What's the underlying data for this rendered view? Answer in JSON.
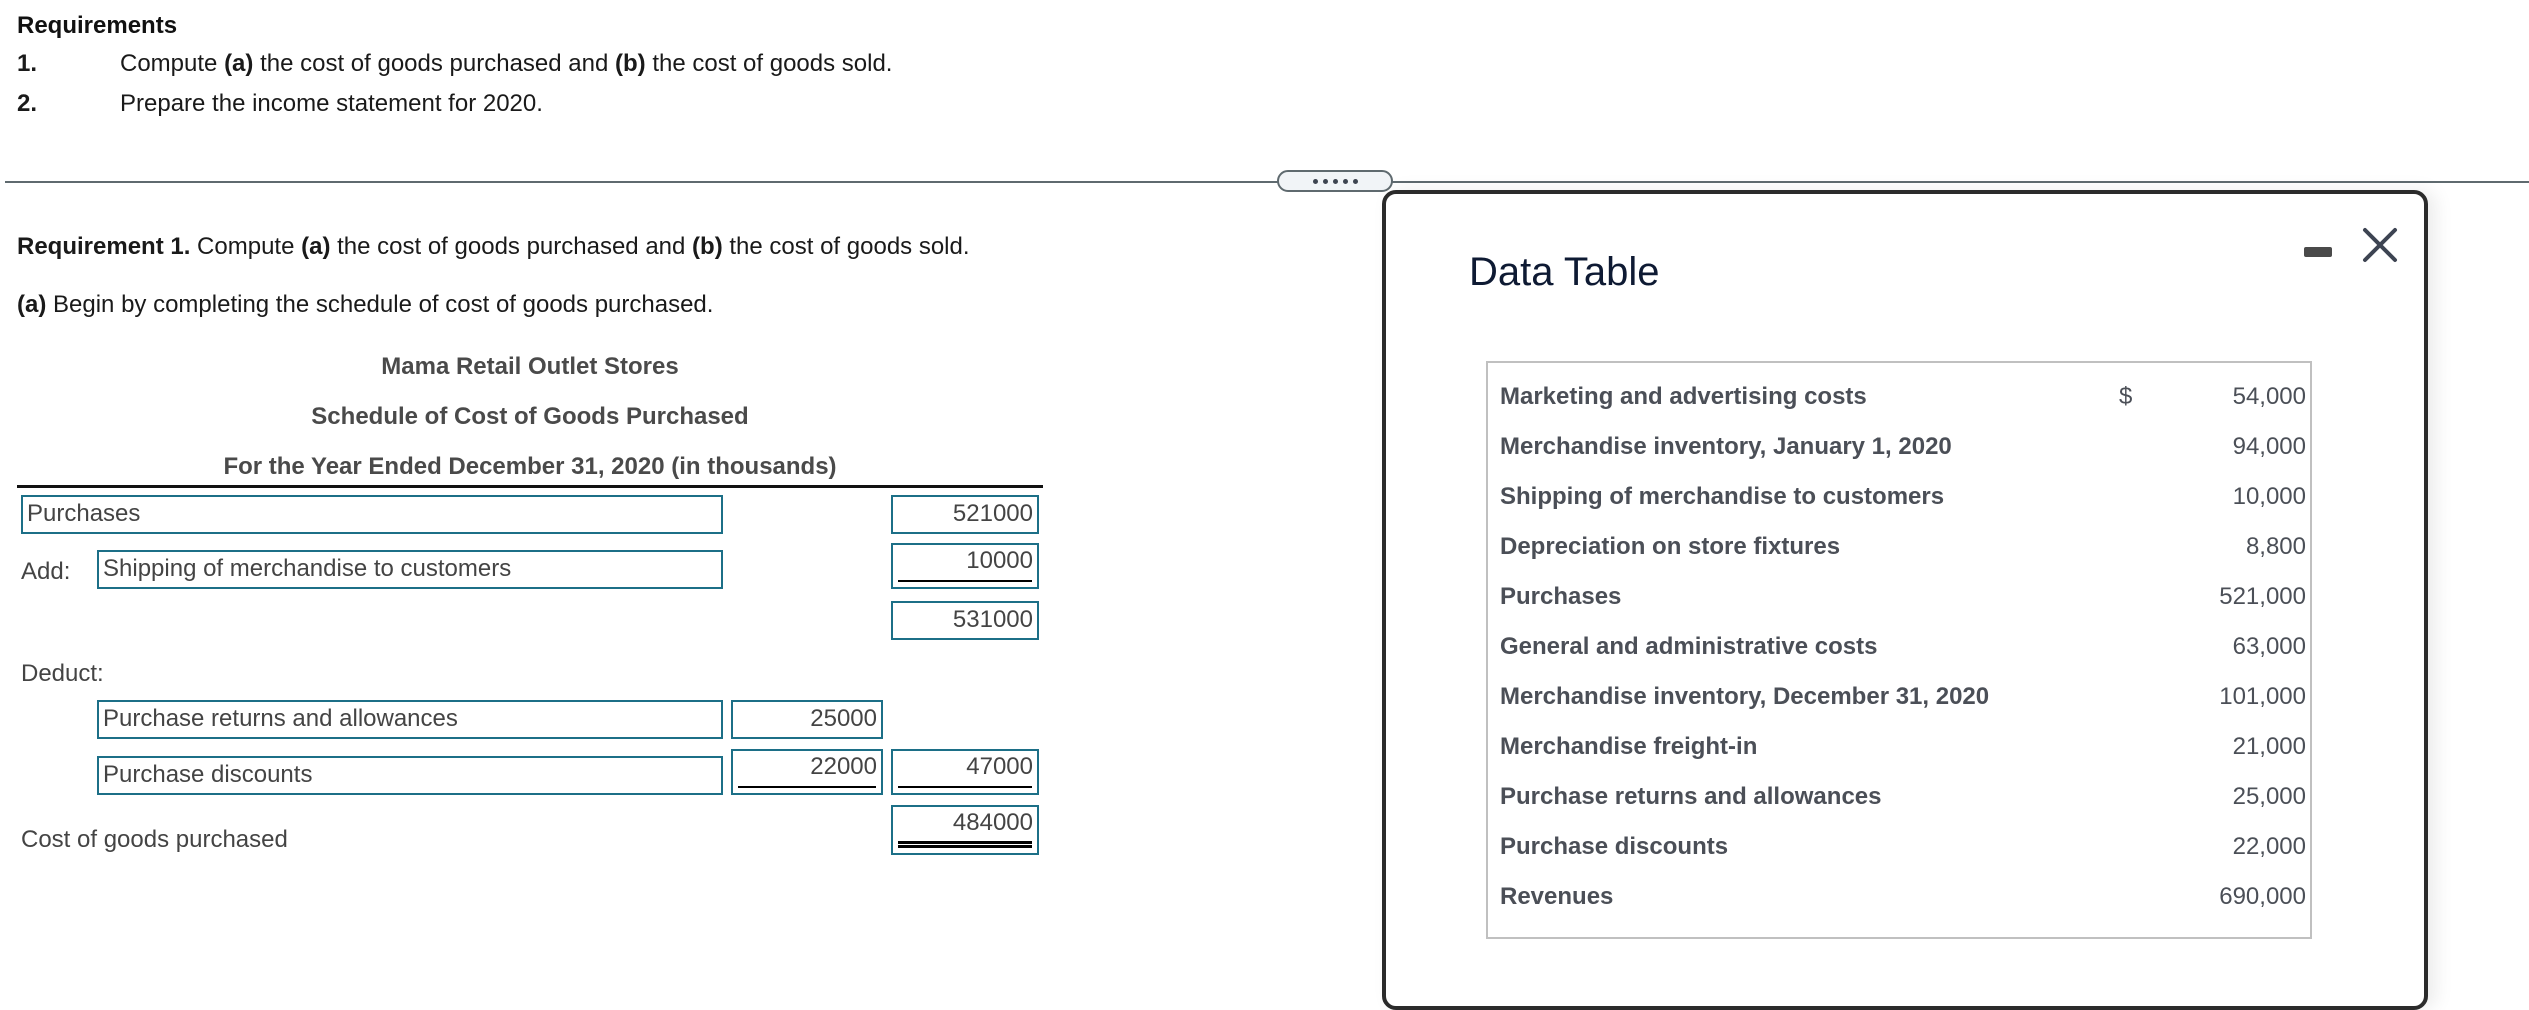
{
  "requirements": {
    "title": "Requirements",
    "items": [
      {
        "num": "1.",
        "parts": [
          {
            "t": "Compute ",
            "b": false
          },
          {
            "t": "(a)",
            "b": true
          },
          {
            "t": " the cost of goods purchased and ",
            "b": false
          },
          {
            "t": "(b)",
            "b": true
          },
          {
            "t": " the cost of goods sold.",
            "b": false
          }
        ]
      },
      {
        "num": "2.",
        "parts": [
          {
            "t": "Prepare the income statement for 2020.",
            "b": false
          }
        ]
      }
    ]
  },
  "question": {
    "req1_bold": "Requirement 1.",
    "req1_text_a": " Compute ",
    "req1_a": "(a)",
    "req1_text_b": " the cost of goods purchased and ",
    "req1_b": "(b)",
    "req1_text_c": " the cost of goods sold.",
    "part_a_bold": "(a)",
    "part_a_text": " Begin by completing the schedule of cost of goods purchased."
  },
  "schedule": {
    "company": "Mama Retail Outlet Stores",
    "title": "Schedule of Cost of Goods Purchased",
    "period": "For the Year Ended December 31, 2020 (in thousands)",
    "add_label": "Add:",
    "deduct_label": "Deduct:",
    "total_label": "Cost of goods purchased",
    "rows": {
      "purchases": {
        "label": "Purchases",
        "value": "521000"
      },
      "shipping": {
        "label": "Shipping of merchandise to customers",
        "value": "10000"
      },
      "subtotal": {
        "value": "531000"
      },
      "returns": {
        "label": "Purchase returns and allowances",
        "value": "25000"
      },
      "discounts": {
        "label": "Purchase discounts",
        "value": "22000",
        "total": "47000"
      },
      "cost_of_goods_purchased": {
        "value": "484000"
      }
    }
  },
  "dialog": {
    "title": "Data Table",
    "minimize_icon": "minimize-icon",
    "close_icon": "close-icon",
    "currency_symbol": "$",
    "rows": [
      {
        "label": "Marketing and advertising costs",
        "value": "54,000",
        "currency": "$"
      },
      {
        "label": "Merchandise inventory, January 1, 2020",
        "value": "94,000"
      },
      {
        "label": "Shipping of merchandise to customers",
        "value": "10,000"
      },
      {
        "label": "Depreciation on store fixtures",
        "value": "8,800"
      },
      {
        "label": "Purchases",
        "value": "521,000"
      },
      {
        "label": "General and administrative costs",
        "value": "63,000"
      },
      {
        "label": "Merchandise inventory, December 31, 2020",
        "value": "101,000"
      },
      {
        "label": "Merchandise freight-in",
        "value": "21,000"
      },
      {
        "label": "Purchase returns and allowances",
        "value": "25,000"
      },
      {
        "label": "Purchase discounts",
        "value": "22,000"
      },
      {
        "label": "Revenues",
        "value": "690,000"
      }
    ]
  },
  "colors": {
    "input_border": "#1c6f87",
    "divider": "#5f6a6f",
    "heading_gray": "#4a4a4a"
  }
}
